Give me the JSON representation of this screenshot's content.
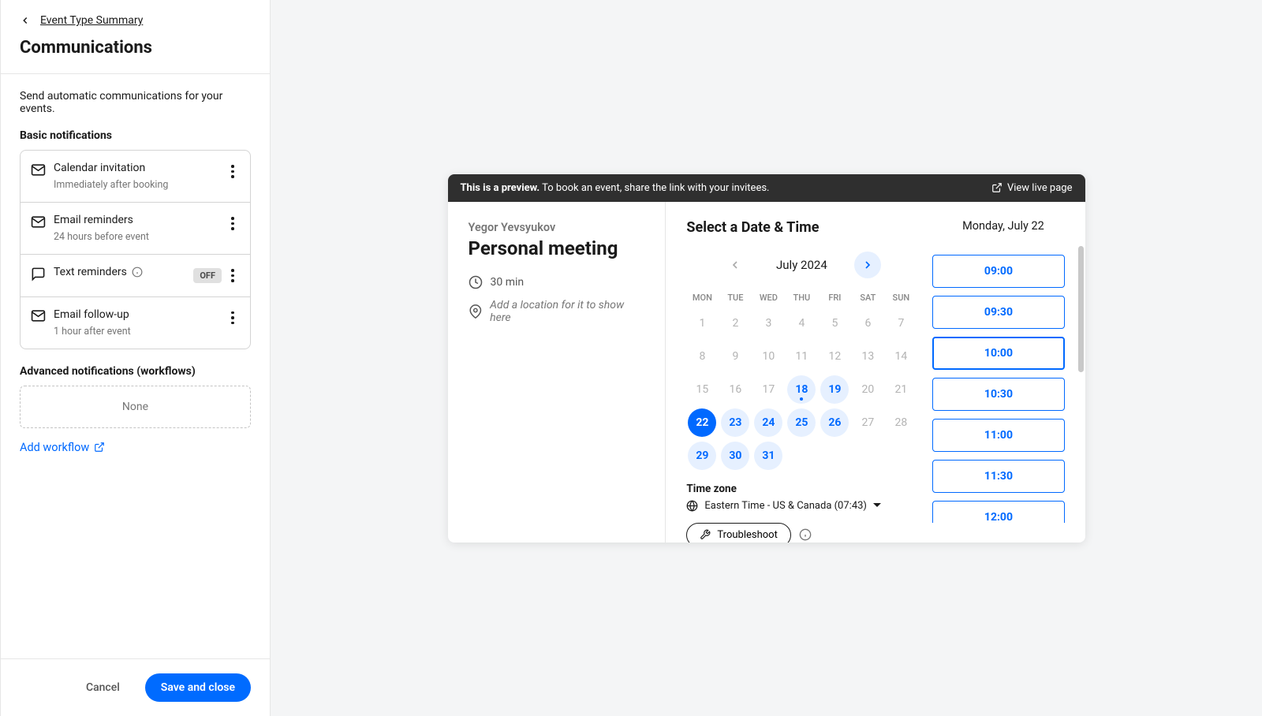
{
  "sidebar": {
    "back_label": "Event Type Summary",
    "title": "Communications",
    "description": "Send automatic communications for your events.",
    "basic_label": "Basic notifications",
    "notifications": [
      {
        "title": "Calendar invitation",
        "sub": "Immediately after booking",
        "icon": "mail",
        "off": false
      },
      {
        "title": "Email reminders",
        "sub": "24 hours before event",
        "icon": "mail",
        "off": false
      },
      {
        "title": "Text reminders",
        "sub": "",
        "icon": "chat",
        "off": true
      },
      {
        "title": "Email follow-up",
        "sub": "1 hour after event",
        "icon": "mail",
        "off": false
      }
    ],
    "advanced_label": "Advanced notifications (workflows)",
    "none_label": "None",
    "add_workflow_label": "Add workflow",
    "cancel_label": "Cancel",
    "save_label": "Save and close"
  },
  "preview": {
    "bar_strong": "This is a preview.",
    "bar_text": " To book an event, share the link with your invitees.",
    "view_live": "View live page",
    "host": "Yegor Yevsyukov",
    "event_title": "Personal meeting",
    "duration": "30 min",
    "location_placeholder": "Add a location for it to show here",
    "select_title": "Select a Date & Time",
    "month": "July 2024",
    "dow": [
      "MON",
      "TUE",
      "WED",
      "THU",
      "FRI",
      "SAT",
      "SUN"
    ],
    "days": [
      {
        "n": "1"
      },
      {
        "n": "2"
      },
      {
        "n": "3"
      },
      {
        "n": "4"
      },
      {
        "n": "5"
      },
      {
        "n": "6"
      },
      {
        "n": "7"
      },
      {
        "n": "8"
      },
      {
        "n": "9"
      },
      {
        "n": "10"
      },
      {
        "n": "11"
      },
      {
        "n": "12"
      },
      {
        "n": "13"
      },
      {
        "n": "14"
      },
      {
        "n": "15"
      },
      {
        "n": "16"
      },
      {
        "n": "17"
      },
      {
        "n": "18",
        "avail": true,
        "today": true
      },
      {
        "n": "19",
        "avail": true
      },
      {
        "n": "20"
      },
      {
        "n": "21"
      },
      {
        "n": "22",
        "selected": true
      },
      {
        "n": "23",
        "avail": true
      },
      {
        "n": "24",
        "avail": true
      },
      {
        "n": "25",
        "avail": true
      },
      {
        "n": "26",
        "avail": true
      },
      {
        "n": "27"
      },
      {
        "n": "28"
      },
      {
        "n": "29",
        "avail": true
      },
      {
        "n": "30",
        "avail": true
      },
      {
        "n": "31",
        "avail": true
      }
    ],
    "tz_label": "Time zone",
    "tz_value": "Eastern Time - US & Canada (07:43)",
    "troubleshoot": "Troubleshoot",
    "selected_date": "Monday, July 22",
    "slots": [
      "09:00",
      "09:30",
      "10:00",
      "10:30",
      "11:00",
      "11:30",
      "12:00"
    ],
    "selected_slot_index": 2,
    "off_badge": "OFF"
  }
}
